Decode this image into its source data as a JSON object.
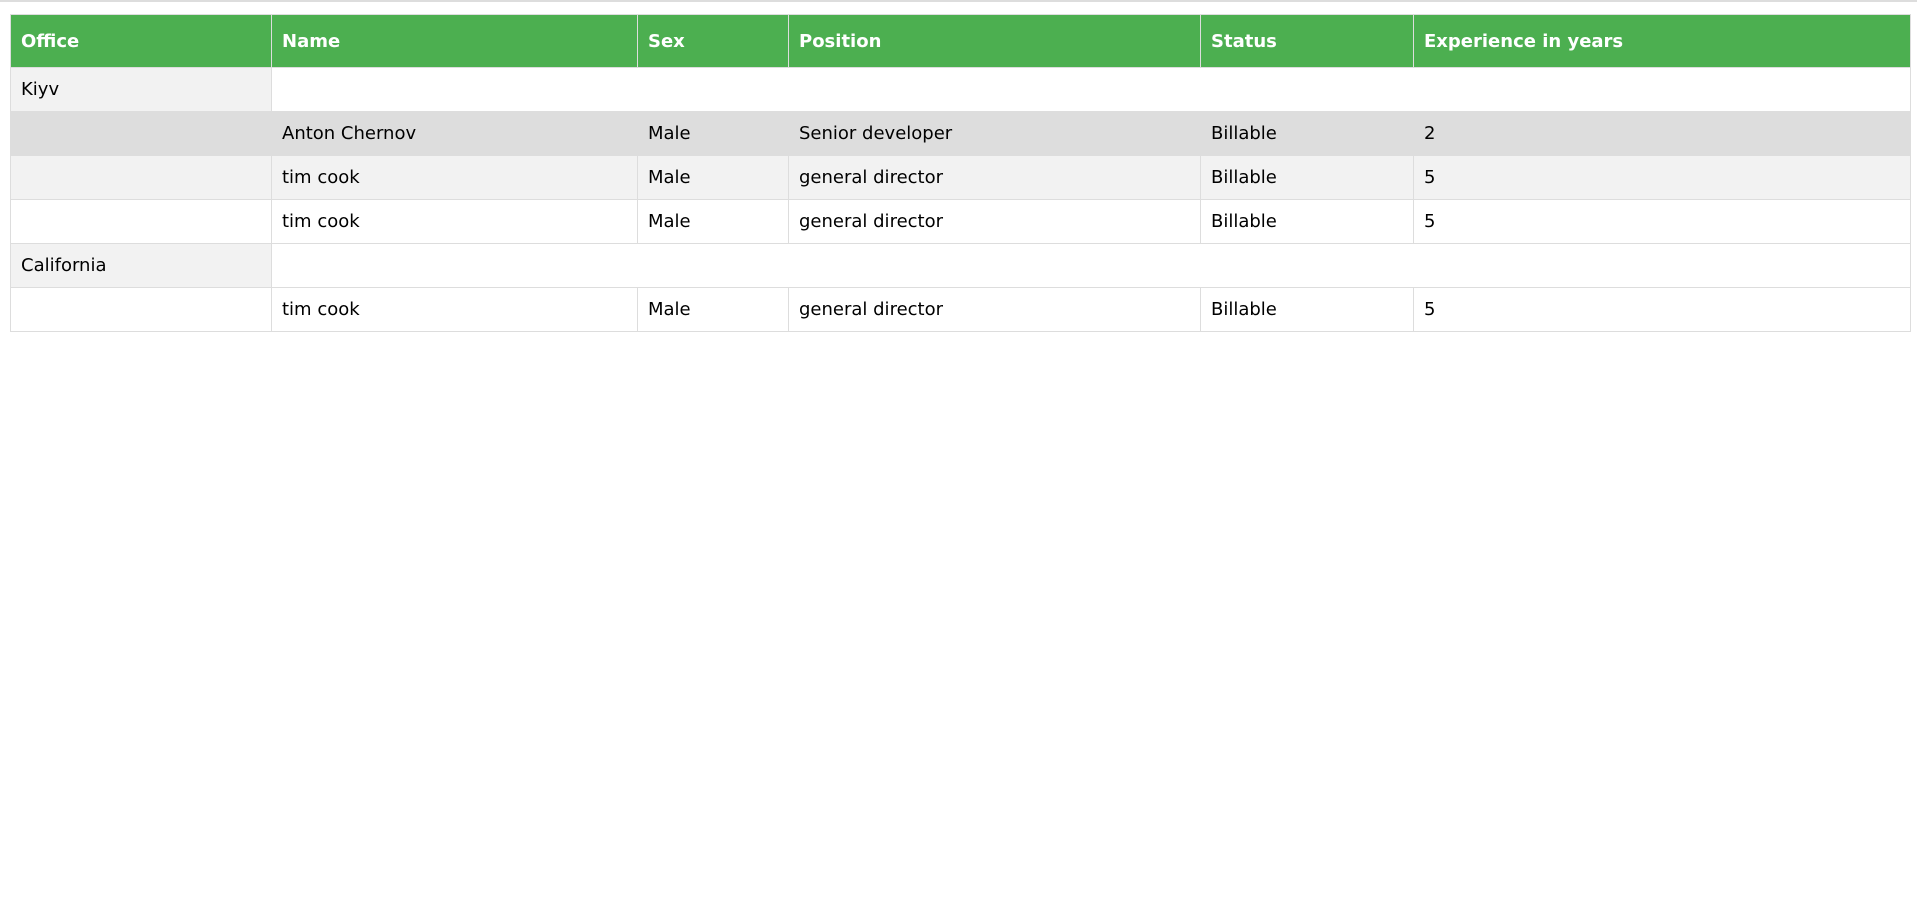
{
  "table": {
    "headers": [
      "Office",
      "Name",
      "Sex",
      "Position",
      "Status",
      "Experience in years"
    ],
    "groups": [
      {
        "office": "Kiyv",
        "rows": [
          {
            "name": "Anton Chernov",
            "sex": "Male",
            "position": "Senior developer",
            "status": "Billable",
            "experience": "2"
          },
          {
            "name": "tim cook",
            "sex": "Male",
            "position": "general director",
            "status": "Billable",
            "experience": "5"
          },
          {
            "name": "tim cook",
            "sex": "Male",
            "position": "general director",
            "status": "Billable",
            "experience": "5"
          }
        ]
      },
      {
        "office": "California",
        "rows": [
          {
            "name": "tim cook",
            "sex": "Male",
            "position": "general director",
            "status": "Billable",
            "experience": "5"
          }
        ]
      }
    ]
  },
  "colors": {
    "header_bg": "#4caf50",
    "header_text": "#ffffff",
    "row_highlight": "#dddddd",
    "row_alt": "#f2f2f2"
  }
}
